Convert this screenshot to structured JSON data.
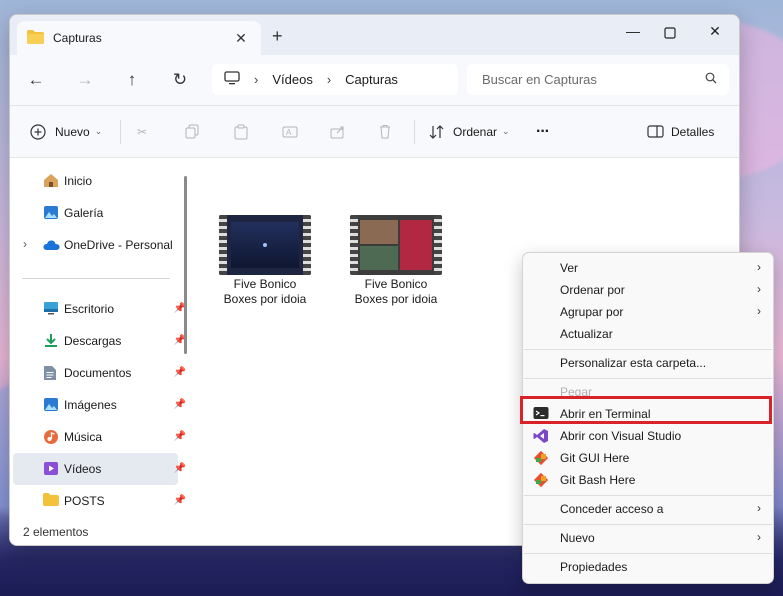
{
  "window": {
    "tab_title": "Capturas",
    "new_tab": "+"
  },
  "address": {
    "crumbs": [
      "Vídeos",
      "Capturas"
    ],
    "search_placeholder": "Buscar en Capturas"
  },
  "toolbar": {
    "new_label": "Nuevo",
    "sort_label": "Ordenar",
    "more_label": "···",
    "details_label": "Detalles"
  },
  "sidebar": {
    "items": [
      {
        "label": "Inicio",
        "icon": "home-icon"
      },
      {
        "label": "Galería",
        "icon": "gallery-icon"
      },
      {
        "label": "OneDrive - Personal",
        "icon": "onedrive-icon"
      },
      {
        "label": "Escritorio",
        "icon": "desktop-icon"
      },
      {
        "label": "Descargas",
        "icon": "download-icon"
      },
      {
        "label": "Documentos",
        "icon": "documents-icon"
      },
      {
        "label": "Imágenes",
        "icon": "pictures-icon"
      },
      {
        "label": "Música",
        "icon": "music-icon"
      },
      {
        "label": "Vídeos",
        "icon": "videos-icon"
      },
      {
        "label": "POSTS",
        "icon": "folder-icon"
      }
    ]
  },
  "files": [
    {
      "name_line1": "Five Bonico",
      "name_line2": "Boxes por idoia"
    },
    {
      "name_line1": "Five Bonico",
      "name_line2": "Boxes por idoia"
    }
  ],
  "status": {
    "count": "2 elementos"
  },
  "context_menu": {
    "items": [
      {
        "label": "Ver"
      },
      {
        "label": "Ordenar por"
      },
      {
        "label": "Agrupar por"
      },
      {
        "label": "Actualizar"
      },
      {
        "label": "Personalizar esta carpeta..."
      },
      {
        "label": "Pegar"
      },
      {
        "label": "Abrir en Terminal"
      },
      {
        "label": "Abrir con Visual Studio"
      },
      {
        "label": "Git GUI Here"
      },
      {
        "label": "Git Bash Here"
      },
      {
        "label": "Conceder acceso a"
      },
      {
        "label": "Nuevo"
      },
      {
        "label": "Propiedades"
      }
    ]
  },
  "colors": {
    "accent": "#0067c0",
    "highlight_box": "#d9222a",
    "folder": "#f3c13a"
  }
}
